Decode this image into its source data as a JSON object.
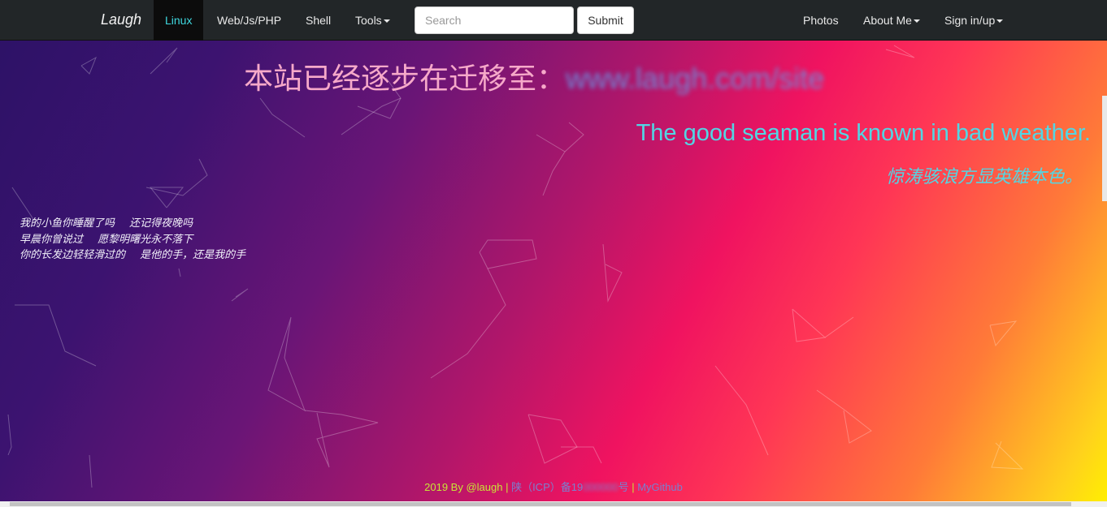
{
  "navbar": {
    "brand": "Laugh",
    "left_items": [
      {
        "label": "Linux",
        "active": true
      },
      {
        "label": "Web/Js/PHP",
        "active": false
      },
      {
        "label": "Shell",
        "active": false
      },
      {
        "label": "Tools",
        "dropdown": true
      }
    ],
    "search": {
      "placeholder": "Search",
      "value": ""
    },
    "submit_label": "Submit",
    "right_items": [
      {
        "label": "Photos",
        "dropdown": false
      },
      {
        "label": "About Me",
        "dropdown": true
      },
      {
        "label": "Sign in/up",
        "dropdown": true
      }
    ],
    "colors": {
      "bar": "#222628",
      "active_text": "#3fd9e0"
    }
  },
  "hero": {
    "announcement": "本站已经逐步在迁移至：",
    "announcement_domain": "www.laugh.com/site",
    "motto_en": "The good seaman is known in bad weather.",
    "motto_zh": "惊涛骇浪方显英雄本色。"
  },
  "poem": {
    "lines": [
      {
        "a": "我的小鱼你睡醒了吗",
        "b": "还记得夜晚吗"
      },
      {
        "a": "早晨你曾说过",
        "b": "愿黎明曙光永不落下"
      },
      {
        "a": "你的长发边轻轻滑过的",
        "b": "是他的手，还是我的手"
      }
    ]
  },
  "footer": {
    "copyright": "2019 By @laugh",
    "sep1": " | ",
    "icp_prefix": "陕（ICP）备19",
    "icp_hidden": "000000",
    "icp_suffix": "号",
    "sep2": " | ",
    "github": "MyGithub"
  },
  "colors": {
    "bg_start": "#2c1266",
    "bg_mid": "#f01360",
    "bg_end": "#fff000",
    "motto": "#52d6e4",
    "footer_text": "#c8e436"
  }
}
